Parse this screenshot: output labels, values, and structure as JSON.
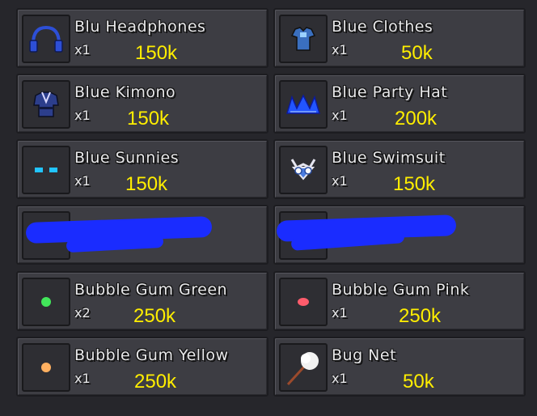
{
  "items": [
    {
      "name": "Blu Headphones",
      "qty": "x1",
      "price": "150k",
      "icon": "headphones-icon",
      "color": "#2d4fd6"
    },
    {
      "name": "Blue Clothes",
      "qty": "x1",
      "price": "50k",
      "icon": "clothes-icon",
      "color": "#3a6fbf"
    },
    {
      "name": "Blue Kimono",
      "qty": "x1",
      "price": "150k",
      "icon": "kimono-icon",
      "color": "#2c3e8c"
    },
    {
      "name": "Blue Party Hat",
      "qty": "x1",
      "price": "200k",
      "icon": "party-hat-icon",
      "color": "#2255ff"
    },
    {
      "name": "Blue Sunnies",
      "qty": "x1",
      "price": "150k",
      "icon": "sunglasses-icon",
      "color": "#22c4ff"
    },
    {
      "name": "Blue Swimsuit",
      "qty": "x1",
      "price": "150k",
      "icon": "swimsuit-icon",
      "color": "#4b7de0"
    },
    {
      "name": "",
      "qty": "",
      "price": "",
      "icon": "redacted-icon",
      "color": "#1a2cff"
    },
    {
      "name": "",
      "qty": "",
      "price": "",
      "icon": "redacted-icon",
      "color": "#1a2cff"
    },
    {
      "name": "Bubble Gum Green",
      "qty": "x2",
      "price": "250k",
      "icon": "green-gum-icon",
      "color": "#42e65a"
    },
    {
      "name": "Bubble Gum Pink",
      "qty": "x1",
      "price": "250k",
      "icon": "pink-gum-icon",
      "color": "#ff5c6c"
    },
    {
      "name": "Bubble Gum Yellow",
      "qty": "x1",
      "price": "250k",
      "icon": "yellow-gum-icon",
      "color": "#ffb060"
    },
    {
      "name": "Bug Net",
      "qty": "x1",
      "price": "50k",
      "icon": "bug-net-icon",
      "color": "#f2f2f2"
    }
  ]
}
